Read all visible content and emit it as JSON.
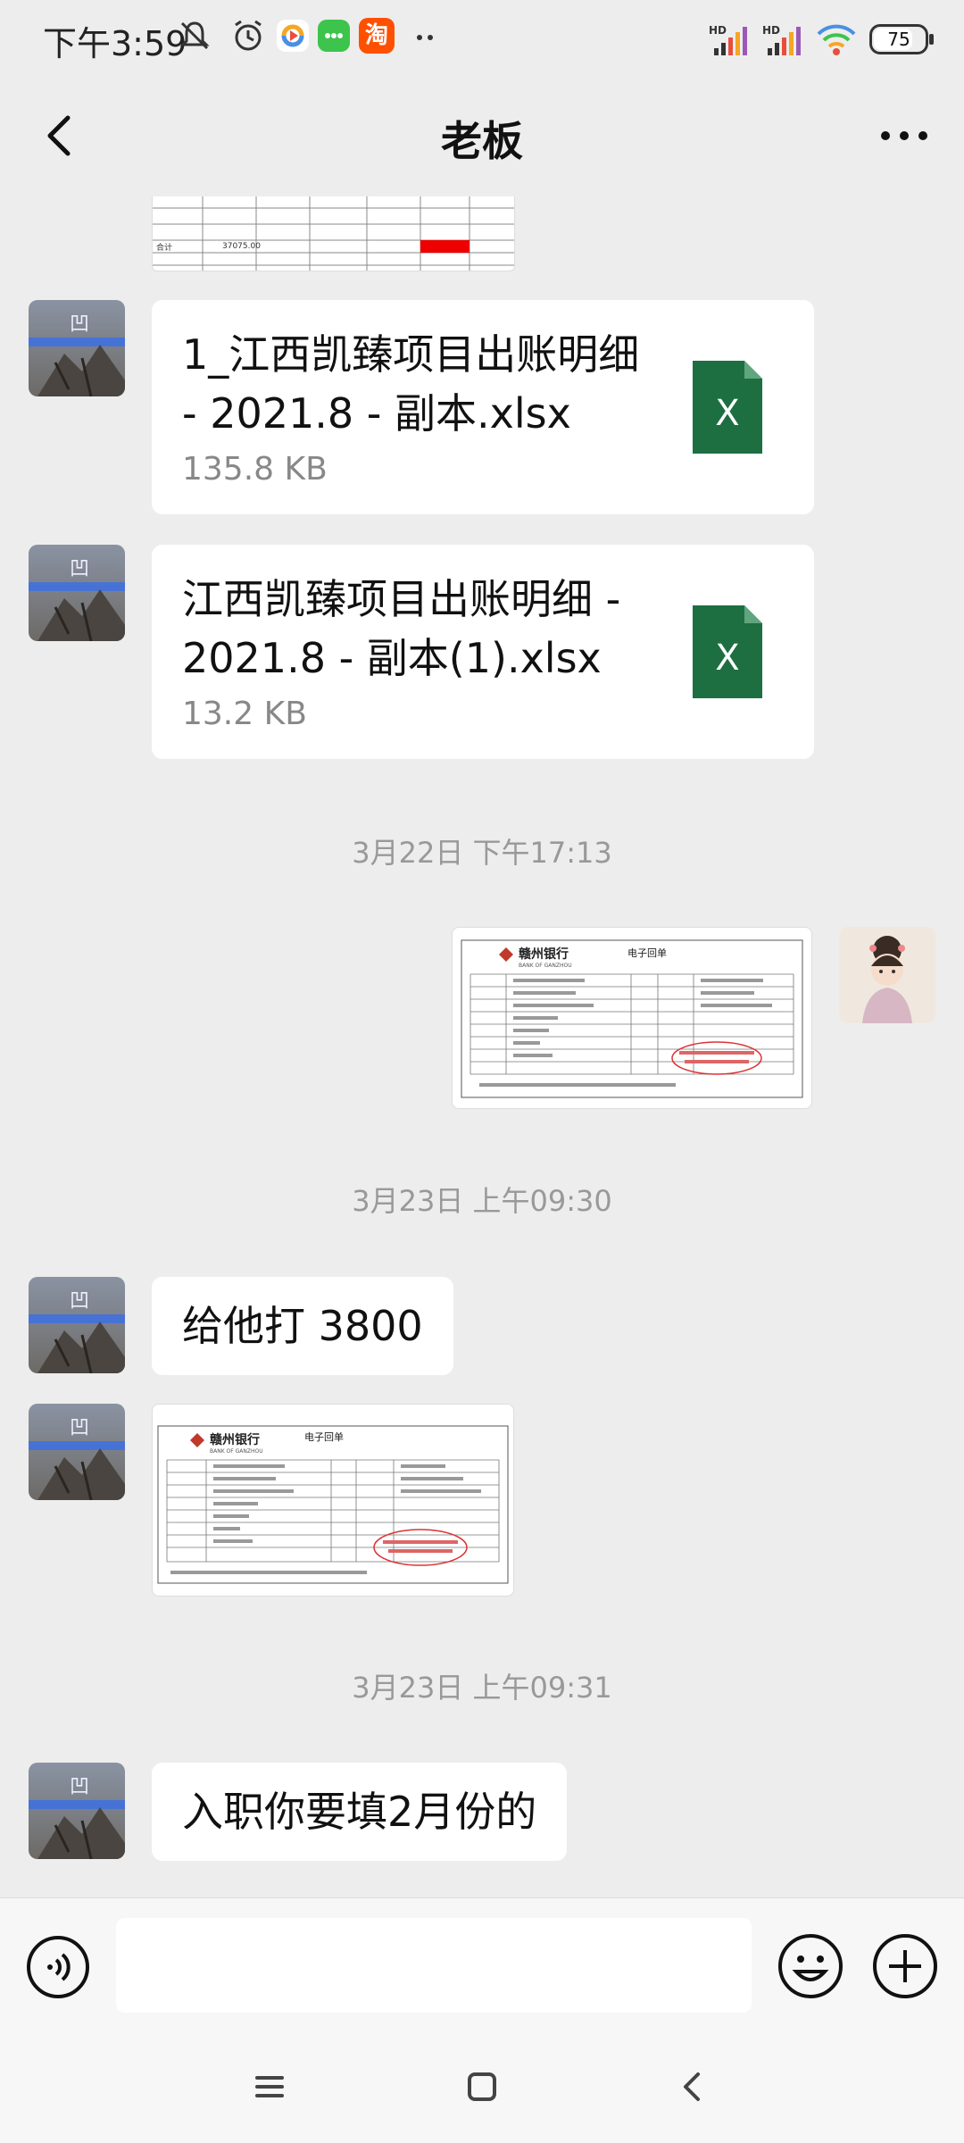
{
  "status_bar": {
    "time": "下午3:59",
    "battery": "75",
    "icons": [
      "mute-icon",
      "alarm-icon",
      "app-icon",
      "message-app-icon",
      "taobao-icon",
      "more-dots-icon",
      "hd-signal-icon",
      "hd-signal-icon",
      "wifi-icon",
      "battery-icon"
    ],
    "taobao_label": "淘"
  },
  "header": {
    "title": "老板",
    "back_icon": "chevron-left-icon",
    "more_icon": "more-dots-icon"
  },
  "messages": {
    "file1": {
      "name": "1_江西凯臻项目出账明细 - 2021.8 - 副本.xlsx",
      "size": "135.8 KB",
      "icon": "excel-icon",
      "icon_letter": "X"
    },
    "file2": {
      "name": "江西凯臻项目出账明细 - 2021.8 - 副本(1).xlsx",
      "size": "13.2 KB",
      "icon": "excel-icon",
      "icon_letter": "X"
    },
    "ts1": "3月22日 下午17:13",
    "ts2": "3月23日 上午09:30",
    "text1": "给他打 3800",
    "ts3": "3月23日 上午09:31",
    "text2": "入职你要填2月份的",
    "receipt": {
      "bank_name": "赣州银行",
      "bank_en": "BANK OF GANZHOU",
      "doc_title": "电子回单"
    },
    "prev_sheet_values": [
      "37075.00"
    ]
  },
  "input_bar": {
    "voice_icon": "voice-icon",
    "placeholder": "",
    "emoji_icon": "emoji-icon",
    "plus_icon": "plus-icon"
  },
  "nav_bar": {
    "icons": [
      "menu-icon",
      "home-icon",
      "back-icon"
    ]
  },
  "colors": {
    "background": "#ededed",
    "bubble": "#ffffff",
    "excel_green": "#1d6f42",
    "timestamp": "#999999"
  }
}
